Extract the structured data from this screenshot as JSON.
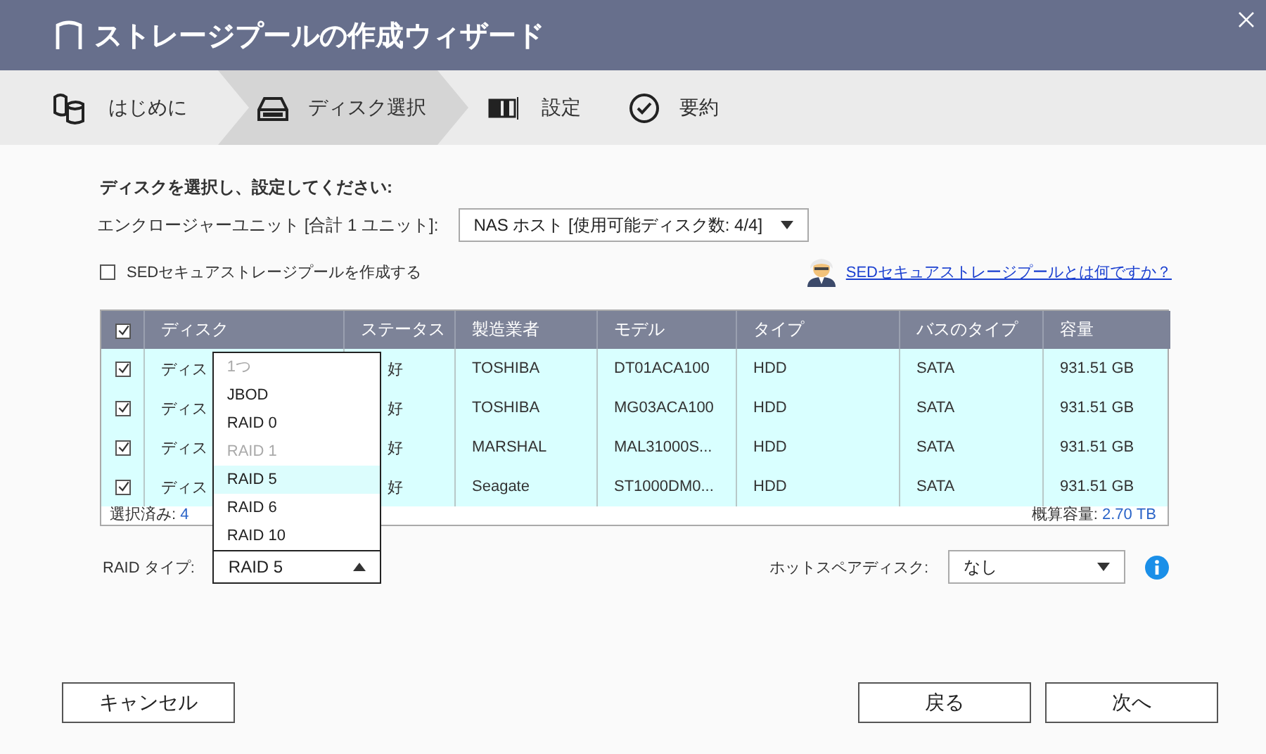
{
  "title": "ストレージプールの作成ウィザード",
  "steps": [
    {
      "label": "はじめに",
      "selected": false,
      "kind": "intro"
    },
    {
      "label": "ディスク選択",
      "selected": true,
      "kind": "disk"
    },
    {
      "label": "設定",
      "selected": false,
      "kind": "config"
    },
    {
      "label": "要約",
      "selected": false,
      "kind": "summary"
    }
  ],
  "instruction": "ディスクを選択し、設定してください:",
  "enclosure": {
    "label": "エンクロージャーユニット [合計 1 ユニット]:",
    "value": "NAS ホスト [使用可能ディスク数: 4/4]"
  },
  "sed": {
    "label": "SEDセキュアストレージプールを作成する",
    "checked": false
  },
  "sed_link": "SEDセキュアストレージプールとは何ですか？",
  "table": {
    "select_all_checked": true,
    "columns": [
      "ディスク",
      "ステータス",
      "製造業者",
      "モデル",
      "タイプ",
      "バスのタイプ",
      "容量"
    ],
    "rows": [
      {
        "checked": true,
        "disk": "ディス",
        "status": "好",
        "manufacturer": "TOSHIBA",
        "model": "DT01ACA100",
        "type": "HDD",
        "bus": "SATA",
        "capacity": "931.51 GB"
      },
      {
        "checked": true,
        "disk": "ディス",
        "status": "好",
        "manufacturer": "TOSHIBA",
        "model": "MG03ACA100",
        "type": "HDD",
        "bus": "SATA",
        "capacity": "931.51 GB"
      },
      {
        "checked": true,
        "disk": "ディス",
        "status": "好",
        "manufacturer": "MARSHAL",
        "model": "MAL31000S...",
        "type": "HDD",
        "bus": "SATA",
        "capacity": "931.51 GB"
      },
      {
        "checked": true,
        "disk": "ディス",
        "status": "好",
        "manufacturer": "Seagate",
        "model": "ST1000DM0...",
        "type": "HDD",
        "bus": "SATA",
        "capacity": "931.51 GB"
      }
    ],
    "selected_label": "選択済み:",
    "selected_count": "4",
    "capacity_label": "概算容量:",
    "capacity_value": "2.70 TB"
  },
  "raid": {
    "label": "RAID タイプ:",
    "value": "RAID 5",
    "expanded": true,
    "options": [
      {
        "label": "1つ",
        "disabled": true,
        "selected": false
      },
      {
        "label": "JBOD",
        "disabled": false,
        "selected": false
      },
      {
        "label": "RAID 0",
        "disabled": false,
        "selected": false
      },
      {
        "label": "RAID 1",
        "disabled": true,
        "selected": false
      },
      {
        "label": "RAID 5",
        "disabled": false,
        "selected": true
      },
      {
        "label": "RAID 6",
        "disabled": false,
        "selected": false
      },
      {
        "label": "RAID 10",
        "disabled": false,
        "selected": false
      }
    ]
  },
  "hot_spare": {
    "label": "ホットスペアディスク:",
    "value": "なし"
  },
  "buttons": {
    "cancel": "キャンセル",
    "back": "戻る",
    "next": "次へ"
  }
}
